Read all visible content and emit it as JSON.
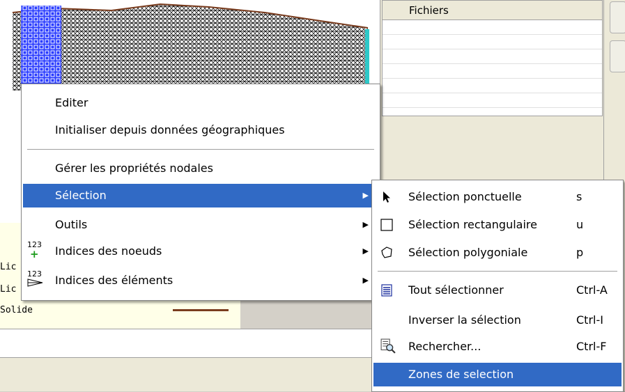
{
  "background": {
    "files_header": "Fichiers",
    "legend_items": [
      "Lic",
      "Lic",
      "Solide"
    ],
    "solid_color": "#7a3c1e"
  },
  "context_menu": {
    "items": [
      {
        "label": "Editer"
      },
      {
        "label": "Initialiser depuis données géographiques"
      },
      {
        "label": "Gérer les propriétés nodales"
      },
      {
        "label": "Sélection",
        "submenu": true,
        "highlighted": true
      },
      {
        "label": "Outils",
        "submenu": true
      },
      {
        "label": "Indices des noeuds",
        "submenu": true,
        "icon": "node-index-icon",
        "icon_text": "123"
      },
      {
        "label": "Indices des éléments",
        "submenu": true,
        "icon": "element-index-icon",
        "icon_text": "123"
      }
    ]
  },
  "selection_submenu": {
    "items": [
      {
        "label": "Sélection ponctuelle",
        "shortcut": "s",
        "icon": "cursor-arrow-icon"
      },
      {
        "label": "Sélection rectangulaire",
        "shortcut": "u",
        "icon": "rectangle-select-icon"
      },
      {
        "label": "Sélection polygoniale",
        "shortcut": "p",
        "icon": "polygon-select-icon"
      },
      {
        "label": "Tout sélectionner",
        "shortcut": "Ctrl-A",
        "icon": "select-all-icon"
      },
      {
        "label": "Inverser la sélection",
        "shortcut": "Ctrl-I"
      },
      {
        "label": "Rechercher...",
        "shortcut": "Ctrl-F",
        "icon": "search-icon"
      },
      {
        "label": "Zones de selection",
        "highlighted": true
      }
    ]
  },
  "colors": {
    "highlight": "#316ac5",
    "mesh_blue": "#2a3cff",
    "mesh_cyan": "#2ec8c8"
  }
}
